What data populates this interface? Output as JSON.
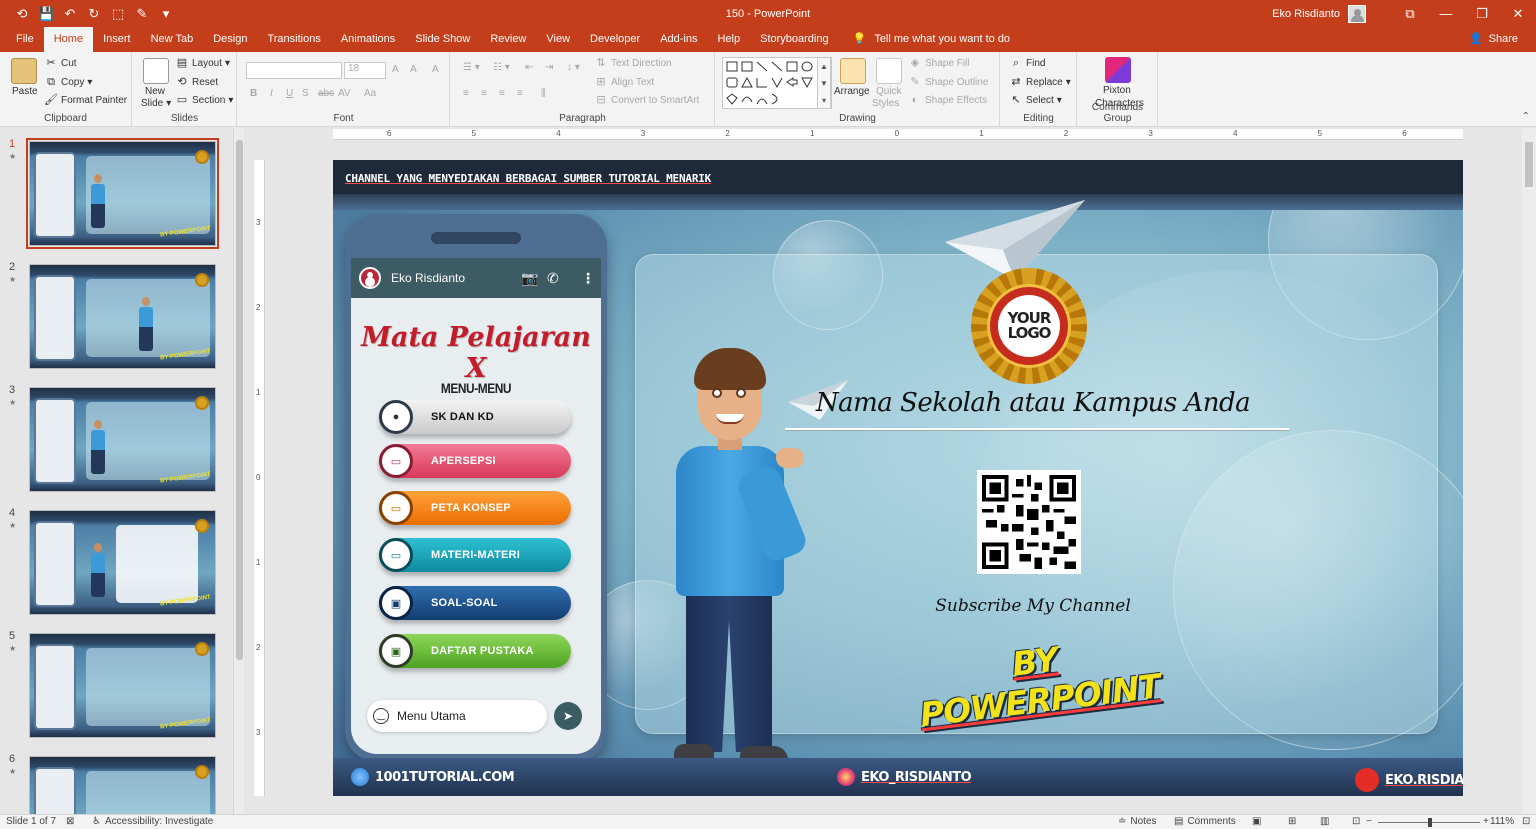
{
  "window": {
    "title": "150  -  PowerPoint",
    "user_name": "Eko Risdianto",
    "min_btn": "—",
    "restore_btn": "❐",
    "close_btn": "✕",
    "ribbon_options": "⧉"
  },
  "qat": {
    "autosave": "⟲",
    "save": "💾",
    "undo": "↶",
    "redo": "↻",
    "start": "⬚",
    "touch": "✎",
    "customize": "▾"
  },
  "tabs": [
    {
      "label": "File"
    },
    {
      "label": "Home"
    },
    {
      "label": "Insert"
    },
    {
      "label": "New Tab"
    },
    {
      "label": "Design"
    },
    {
      "label": "Transitions"
    },
    {
      "label": "Animations"
    },
    {
      "label": "Slide Show"
    },
    {
      "label": "Review"
    },
    {
      "label": "View"
    },
    {
      "label": "Developer"
    },
    {
      "label": "Add-ins"
    },
    {
      "label": "Help"
    },
    {
      "label": "Storyboarding"
    }
  ],
  "tell_me": "Tell me what you want to do",
  "share": "Share",
  "ribbon": {
    "clipboard": {
      "label": "Clipboard",
      "paste": "Paste",
      "cut": "Cut",
      "copy": "Copy",
      "format_painter": "Format Painter"
    },
    "slides": {
      "label": "Slides",
      "new_slide": "New",
      "new_slide2": "Slide",
      "layout": "Layout",
      "reset": "Reset",
      "section": "Section"
    },
    "font": {
      "label": "Font",
      "size": "18",
      "bold": "B",
      "italic": "I",
      "underline": "U",
      "strike": "S",
      "abc": "abc",
      "spacing": "AV",
      "case": "Aa",
      "grow": "A",
      "shrink": "A",
      "clear": "A"
    },
    "paragraph": {
      "label": "Paragraph",
      "text_direction": "Text Direction",
      "align_text": "Align Text",
      "smartart": "Convert to SmartArt"
    },
    "drawing": {
      "label": "Drawing",
      "arrange": "Arrange",
      "quick_styles": "Quick",
      "quick_styles2": "Styles",
      "shape_fill": "Shape Fill",
      "shape_outline": "Shape Outline",
      "shape_effects": "Shape Effects"
    },
    "editing": {
      "label": "Editing",
      "find": "Find",
      "replace": "Replace",
      "select": "Select"
    },
    "pixton": {
      "label": "Commands Group",
      "name1": "Pixton",
      "name2": "Characters"
    }
  },
  "ruler": {
    "h_ticks": [
      "6",
      "5",
      "4",
      "3",
      "2",
      "1",
      "0",
      "1",
      "2",
      "3",
      "4",
      "5",
      "6"
    ],
    "v_ticks": [
      "3",
      "2",
      "1",
      "0",
      "1",
      "2",
      "3"
    ]
  },
  "thumbnails": [
    {
      "num": "1",
      "star": "★"
    },
    {
      "num": "2",
      "star": "★"
    },
    {
      "num": "3",
      "star": "★"
    },
    {
      "num": "4",
      "star": "★"
    },
    {
      "num": "5",
      "star": "★"
    },
    {
      "num": "6",
      "star": "★"
    }
  ],
  "slide": {
    "header": "CHANNEL YANG MENYEDIAKAN BERBAGAI SUMBER TUTORIAL MENARIK",
    "phone": {
      "name": "Eko Risdianto",
      "subject": "Mata Pelajaran X",
      "menu_title": "MENU-MENU",
      "menu": [
        {
          "label": "SK DAN KD",
          "color": "#d9d9d9"
        },
        {
          "label": "APERSEPSI",
          "color": "#e8506e"
        },
        {
          "label": "PETA KONSEP",
          "color": "#f57f0f"
        },
        {
          "label": "MATERI-MATERI",
          "color": "#16a2b7"
        },
        {
          "label": "SOAL-SOAL",
          "color": "#1d4f8a"
        },
        {
          "label": "DAFTAR PUSTAKA",
          "color": "#6cbf3a"
        }
      ],
      "chat_placeholder": "Menu Utama"
    },
    "logo_line1": "YOUR",
    "logo_line2": "LOGO",
    "school": "Nama Sekolah atau Kampus Anda",
    "subscribe": "Subscribe My Channel",
    "brand": "BY POWERPOINT",
    "footer": {
      "website": "1001TUTORIAL.COM",
      "instagram": "EKO_RISDIANTO",
      "youtube": "EKO.RISDIANTO"
    }
  },
  "status": {
    "slide_of": "Slide 1 of 7",
    "accessibility": "Accessibility: Investigate",
    "notes": "Notes",
    "comments": "Comments",
    "zoom_minus": "−",
    "zoom_plus": "+",
    "zoom": "111%"
  },
  "colors": {
    "accent": "#c43e1c",
    "ribbon_bg": "#f3f3f3"
  }
}
